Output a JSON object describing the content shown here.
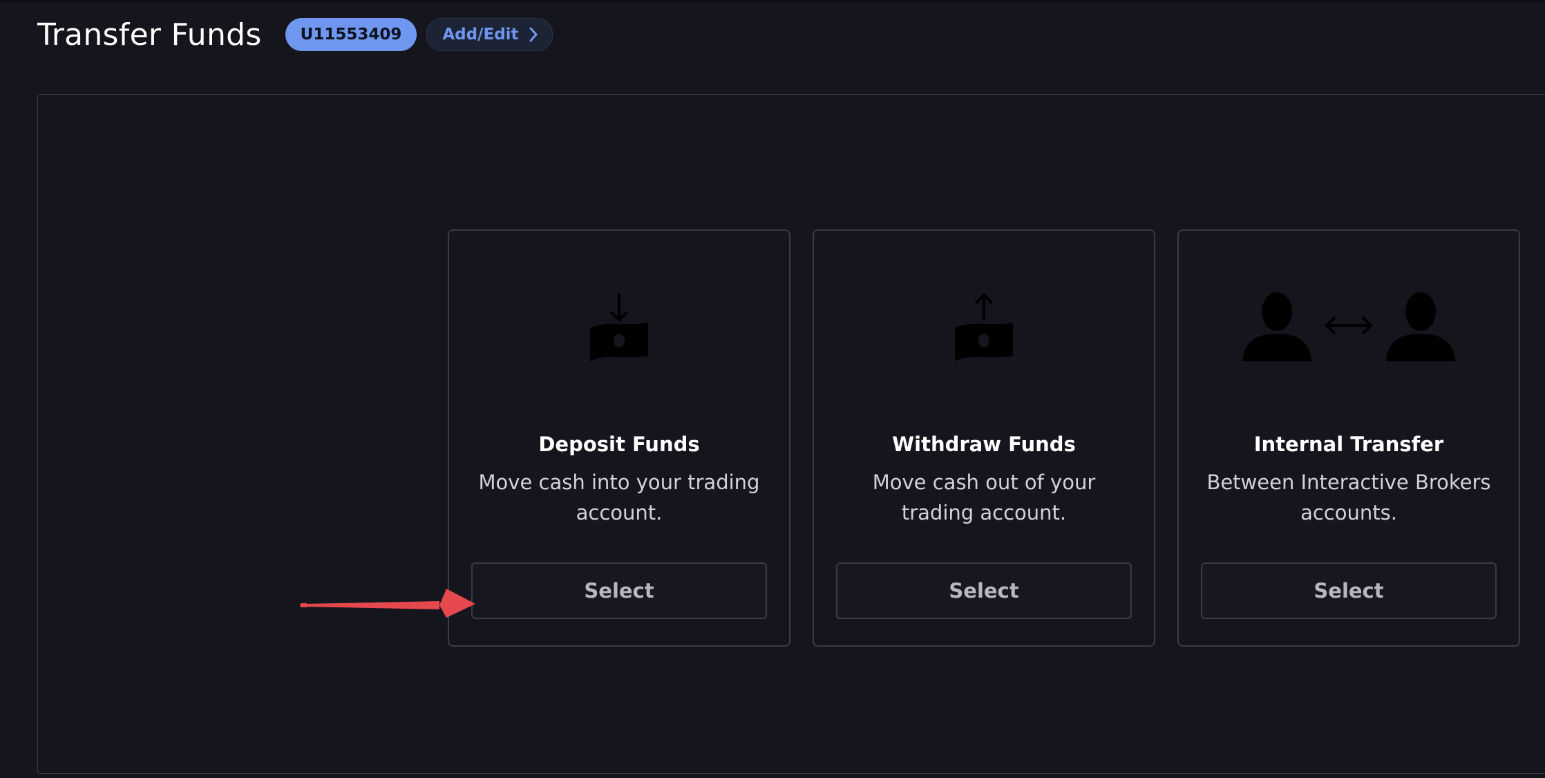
{
  "header": {
    "title": "Transfer Funds",
    "account_id": "U11553409",
    "add_edit_label": "Add/Edit"
  },
  "cards": [
    {
      "icon": "deposit-money-icon",
      "title": "Deposit Funds",
      "description": "Move cash into your trading account.",
      "button_label": "Select"
    },
    {
      "icon": "withdraw-money-icon",
      "title": "Withdraw Funds",
      "description": "Move cash out of your trading account.",
      "button_label": "Select"
    },
    {
      "icon": "internal-transfer-icon",
      "title": "Internal Transfer",
      "description": "Between Interactive Brokers accounts.",
      "button_label": "Select"
    }
  ],
  "colors": {
    "background": "#15161d",
    "accent": "#6f97f0",
    "annotation_arrow": "#e5484d"
  }
}
